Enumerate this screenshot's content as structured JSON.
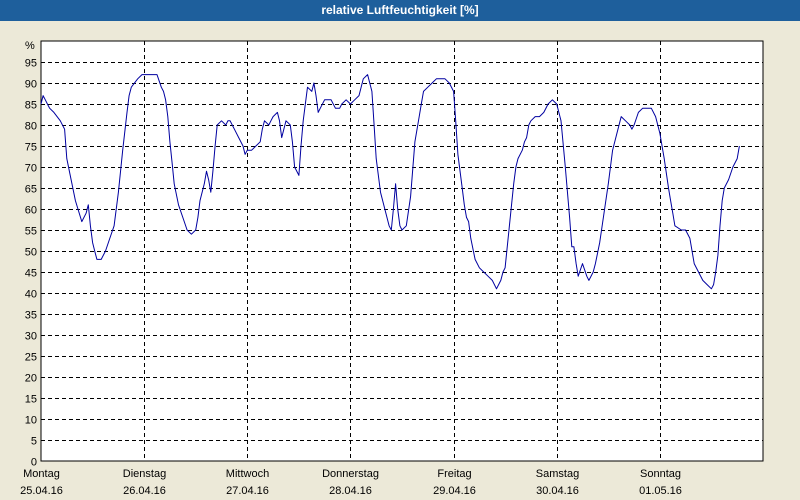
{
  "window": {
    "title": "relative Luftfeuchtigkeit [%]"
  },
  "chart_data": {
    "type": "line",
    "title": "relative Luftfeuchtigkeit [%]",
    "ylabel": "%",
    "xlabel": "",
    "ylim": [
      0,
      100
    ],
    "yticks": [
      0,
      5,
      10,
      15,
      20,
      25,
      30,
      35,
      40,
      45,
      50,
      55,
      60,
      65,
      70,
      75,
      80,
      85,
      90,
      95
    ],
    "grid": true,
    "legend": "none",
    "x_unit": "hours since 25.04.16 00:00",
    "xlim": [
      0,
      168
    ],
    "days": [
      {
        "weekday": "Montag",
        "date": "25.04.16"
      },
      {
        "weekday": "Dienstag",
        "date": "26.04.16"
      },
      {
        "weekday": "Mittwoch",
        "date": "27.04.16"
      },
      {
        "weekday": "Donnerstag",
        "date": "28.04.16"
      },
      {
        "weekday": "Freitag",
        "date": "29.04.16"
      },
      {
        "weekday": "Samstag",
        "date": "30.04.16"
      },
      {
        "weekday": "Sonntag",
        "date": "01.05.16"
      }
    ],
    "colors": {
      "line": "#0000A0",
      "grid": "#000000",
      "plot_bg": "#FFFFFF",
      "title_bar": "#1E5F9C"
    },
    "series": [
      {
        "name": "",
        "points": [
          [
            0.0,
            85
          ],
          [
            0.5,
            87
          ],
          [
            1.0,
            86
          ],
          [
            1.5,
            85
          ],
          [
            2.0,
            84
          ],
          [
            3.0,
            83
          ],
          [
            4.5,
            81
          ],
          [
            5.5,
            79
          ],
          [
            6.0,
            72
          ],
          [
            7.0,
            67
          ],
          [
            8.0,
            62
          ],
          [
            9.5,
            57
          ],
          [
            10.5,
            59
          ],
          [
            11.0,
            61
          ],
          [
            11.5,
            56
          ],
          [
            12.0,
            52
          ],
          [
            12.5,
            50
          ],
          [
            13.0,
            48
          ],
          [
            14.0,
            48
          ],
          [
            15.0,
            50
          ],
          [
            16.0,
            53
          ],
          [
            17.0,
            56
          ],
          [
            18.0,
            64
          ],
          [
            19.0,
            74
          ],
          [
            20.0,
            83
          ],
          [
            20.5,
            87
          ],
          [
            21.0,
            89
          ],
          [
            22.5,
            91
          ],
          [
            23.5,
            92
          ],
          [
            25.0,
            92
          ],
          [
            26.0,
            92
          ],
          [
            27.0,
            92
          ],
          [
            28.0,
            89
          ],
          [
            28.5,
            88
          ],
          [
            29.0,
            86
          ],
          [
            29.5,
            82
          ],
          [
            30.0,
            76
          ],
          [
            30.5,
            71
          ],
          [
            31.0,
            66
          ],
          [
            32.0,
            61
          ],
          [
            33.0,
            58
          ],
          [
            34.0,
            55
          ],
          [
            35.0,
            54
          ],
          [
            36.0,
            55
          ],
          [
            36.5,
            58
          ],
          [
            37.0,
            62
          ],
          [
            38.0,
            66
          ],
          [
            38.5,
            69
          ],
          [
            39.0,
            67
          ],
          [
            39.5,
            64
          ],
          [
            40.0,
            69
          ],
          [
            40.5,
            75
          ],
          [
            41.0,
            80
          ],
          [
            42.0,
            81
          ],
          [
            43.0,
            80
          ],
          [
            43.5,
            81
          ],
          [
            44.0,
            81
          ],
          [
            45.0,
            79
          ],
          [
            46.0,
            77
          ],
          [
            47.0,
            75
          ],
          [
            47.5,
            73
          ],
          [
            48.0,
            74
          ],
          [
            49.0,
            74
          ],
          [
            50.0,
            75
          ],
          [
            51.0,
            76
          ],
          [
            51.5,
            79
          ],
          [
            52.0,
            81
          ],
          [
            53.0,
            80
          ],
          [
            53.5,
            81
          ],
          [
            54.0,
            82
          ],
          [
            55.0,
            83
          ],
          [
            55.5,
            81
          ],
          [
            56.0,
            77
          ],
          [
            57.0,
            81
          ],
          [
            58.0,
            80
          ],
          [
            58.5,
            76
          ],
          [
            59.0,
            70
          ],
          [
            60.0,
            68
          ],
          [
            60.5,
            75
          ],
          [
            61.0,
            81
          ],
          [
            62.0,
            89
          ],
          [
            63.0,
            88
          ],
          [
            63.5,
            90
          ],
          [
            64.0,
            87
          ],
          [
            64.5,
            83
          ],
          [
            65.0,
            84
          ],
          [
            66.0,
            86
          ],
          [
            67.0,
            86
          ],
          [
            67.5,
            86
          ],
          [
            68.5,
            84
          ],
          [
            69.5,
            84
          ],
          [
            70.0,
            85
          ],
          [
            71.0,
            86
          ],
          [
            72.0,
            85
          ],
          [
            73.0,
            86
          ],
          [
            74.0,
            87
          ],
          [
            75.0,
            91
          ],
          [
            76.0,
            92
          ],
          [
            77.0,
            88
          ],
          [
            77.5,
            80
          ],
          [
            78.0,
            72
          ],
          [
            79.0,
            64
          ],
          [
            80.0,
            60
          ],
          [
            81.0,
            56
          ],
          [
            81.5,
            55
          ],
          [
            82.0,
            60
          ],
          [
            82.5,
            66
          ],
          [
            83.0,
            60
          ],
          [
            83.5,
            56
          ],
          [
            84.0,
            55
          ],
          [
            85.0,
            56
          ],
          [
            86.0,
            63
          ],
          [
            87.0,
            76
          ],
          [
            88.0,
            82
          ],
          [
            88.5,
            85
          ],
          [
            89.0,
            88
          ],
          [
            90.0,
            89
          ],
          [
            91.0,
            90
          ],
          [
            92.0,
            91
          ],
          [
            93.0,
            91
          ],
          [
            94.0,
            91
          ],
          [
            95.0,
            90
          ],
          [
            96.0,
            88
          ],
          [
            96.5,
            81
          ],
          [
            97.0,
            73
          ],
          [
            98.0,
            65
          ],
          [
            98.5,
            61
          ],
          [
            99.0,
            58
          ],
          [
            99.5,
            57
          ],
          [
            100.0,
            53
          ],
          [
            101.0,
            48
          ],
          [
            102.0,
            46
          ],
          [
            103.0,
            45
          ],
          [
            104.0,
            44
          ],
          [
            105.0,
            43
          ],
          [
            106.0,
            41
          ],
          [
            107.0,
            43
          ],
          [
            107.5,
            45
          ],
          [
            108.0,
            46
          ],
          [
            109.0,
            56
          ],
          [
            110.0,
            66
          ],
          [
            110.5,
            70
          ],
          [
            111.0,
            72
          ],
          [
            112.0,
            74
          ],
          [
            112.5,
            76
          ],
          [
            113.0,
            77
          ],
          [
            113.5,
            80
          ],
          [
            114.0,
            81
          ],
          [
            115.0,
            82
          ],
          [
            116.0,
            82
          ],
          [
            117.0,
            83
          ],
          [
            118.0,
            85
          ],
          [
            119.0,
            86
          ],
          [
            120.0,
            85
          ],
          [
            121.0,
            81
          ],
          [
            122.0,
            70
          ],
          [
            123.0,
            58
          ],
          [
            123.5,
            51
          ],
          [
            124.0,
            51
          ],
          [
            124.5,
            47
          ],
          [
            125.0,
            44
          ],
          [
            126.0,
            47
          ],
          [
            127.0,
            44
          ],
          [
            127.5,
            43
          ],
          [
            128.5,
            45
          ],
          [
            129.0,
            47
          ],
          [
            130.0,
            52
          ],
          [
            131.0,
            59
          ],
          [
            132.0,
            66
          ],
          [
            133.0,
            74
          ],
          [
            134.0,
            78
          ],
          [
            135.0,
            82
          ],
          [
            136.0,
            81
          ],
          [
            137.0,
            80
          ],
          [
            137.5,
            79
          ],
          [
            138.0,
            80
          ],
          [
            139.0,
            83
          ],
          [
            140.0,
            84
          ],
          [
            141.0,
            84
          ],
          [
            142.0,
            84
          ],
          [
            143.0,
            82
          ],
          [
            144.0,
            78
          ],
          [
            145.0,
            72
          ],
          [
            146.0,
            65
          ],
          [
            146.5,
            62
          ],
          [
            147.0,
            59
          ],
          [
            147.5,
            56
          ],
          [
            149.0,
            55
          ],
          [
            150.0,
            55
          ],
          [
            151.0,
            53
          ],
          [
            152.0,
            47
          ],
          [
            153.0,
            45
          ],
          [
            154.0,
            43
          ],
          [
            155.0,
            42
          ],
          [
            156.0,
            41
          ],
          [
            156.5,
            42
          ],
          [
            157.0,
            45
          ],
          [
            157.5,
            49
          ],
          [
            158.0,
            56
          ],
          [
            158.5,
            62
          ],
          [
            159.0,
            65
          ],
          [
            160.0,
            67
          ],
          [
            161.0,
            70
          ],
          [
            162.0,
            72
          ],
          [
            162.5,
            75
          ]
        ]
      }
    ]
  }
}
